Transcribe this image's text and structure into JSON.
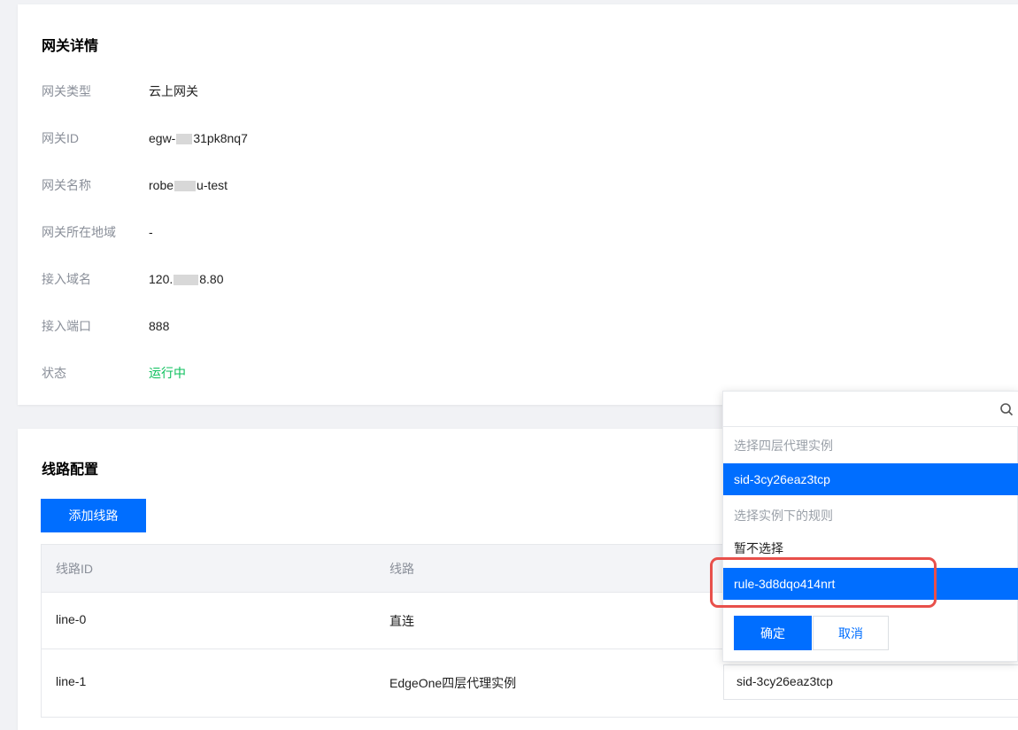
{
  "gateway_detail": {
    "title": "网关详情",
    "rows": [
      {
        "label": "网关类型",
        "value": "云上网关"
      },
      {
        "label": "网关ID",
        "value_prefix": "egw-",
        "value_suffix": "31pk8nq7"
      },
      {
        "label": "网关名称",
        "value_prefix": "robe",
        "value_suffix": "u-test"
      },
      {
        "label": "网关所在地域",
        "value": "-"
      },
      {
        "label": "接入域名",
        "value_prefix": "120.",
        "value_suffix": "8.80"
      },
      {
        "label": "接入端口",
        "value": "888"
      },
      {
        "label": "状态",
        "value": "运行中"
      }
    ]
  },
  "line_config": {
    "title": "线路配置",
    "add_button": "添加线路",
    "columns": [
      "线路ID",
      "线路"
    ],
    "rows": [
      {
        "id": "line-0",
        "line": "直连"
      },
      {
        "id": "line-1",
        "line": "EdgeOne四层代理实例",
        "select_value": "sid-3cy26eaz3tcp"
      }
    ]
  },
  "dropdown": {
    "search_placeholder": "",
    "group_instance": "选择四层代理实例",
    "instance_selected": "sid-3cy26eaz3tcp",
    "group_rule": "选择实例下的规则",
    "rule_none": "暂不选择",
    "rule_selected": "rule-3d8dqo414nrt",
    "ok_button": "确定",
    "cancel_button": "取消"
  },
  "colors": {
    "primary": "#006eff",
    "running": "#0abf5b",
    "highlight": "#e8504b"
  }
}
